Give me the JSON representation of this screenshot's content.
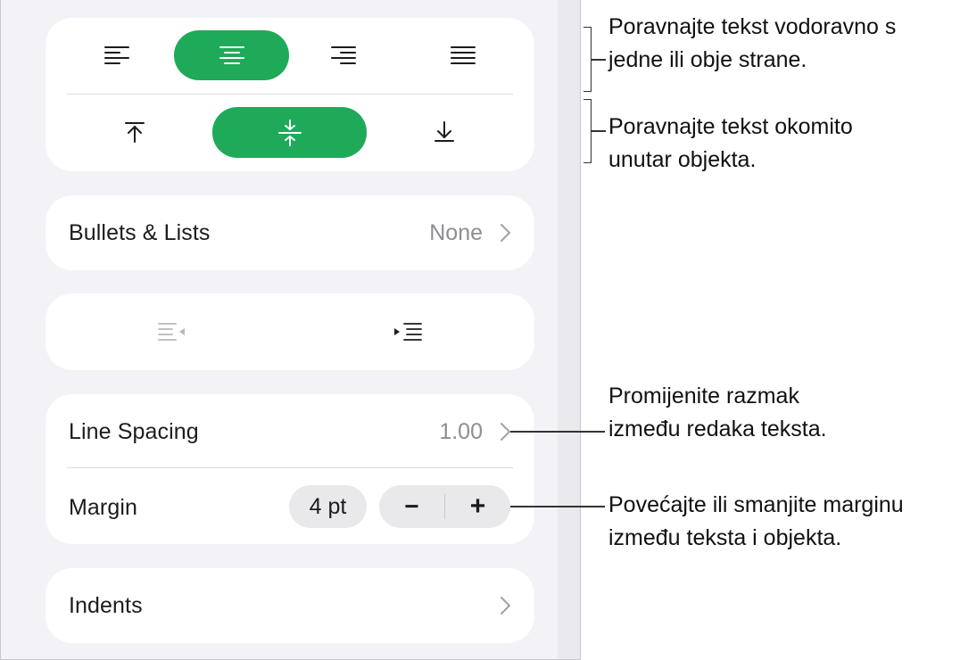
{
  "panel": {
    "text_align_horizontal": [
      {
        "name": "align-left",
        "icon": "text-align-left-icon",
        "selected": false
      },
      {
        "name": "align-center",
        "icon": "text-align-center-icon",
        "selected": true
      },
      {
        "name": "align-right",
        "icon": "text-align-right-icon",
        "selected": false
      },
      {
        "name": "justify",
        "icon": "text-justify-icon",
        "selected": false
      }
    ],
    "text_align_vertical": [
      {
        "name": "align-top",
        "icon": "align-top-arrow-icon",
        "selected": false
      },
      {
        "name": "align-middle",
        "icon": "align-middle-arrows-icon",
        "selected": true
      },
      {
        "name": "align-bottom",
        "icon": "align-bottom-arrow-icon",
        "selected": false
      }
    ],
    "bullets": {
      "label": "Bullets & Lists",
      "value": "None"
    },
    "indent_buttons": [
      {
        "name": "decrease-indent",
        "icon": "outdent-icon",
        "enabled": false
      },
      {
        "name": "increase-indent",
        "icon": "indent-icon",
        "enabled": true
      }
    ],
    "line_spacing": {
      "label": "Line Spacing",
      "value": "1.00"
    },
    "margin": {
      "label": "Margin",
      "value": "4 pt",
      "decrement": "−",
      "increment": "+"
    },
    "indents": {
      "label": "Indents"
    }
  },
  "callouts": {
    "horizontal": {
      "line1": "Poravnajte tekst vodoravno s",
      "line2": "jedne ili obje strane."
    },
    "vertical": {
      "line1": "Poravnajte tekst okomito",
      "line2": "unutar objekta."
    },
    "spacing": {
      "line1": "Promijenite razmak",
      "line2": "između redaka teksta."
    },
    "margin": {
      "line1": "Povećajte ili smanjite marginu",
      "line2": "između teksta i objekta."
    }
  },
  "colors": {
    "accent": "#1faa59",
    "panel_bg": "#f2f2f7",
    "card_bg": "#ffffff",
    "secondary_text": "#8e8e93"
  }
}
